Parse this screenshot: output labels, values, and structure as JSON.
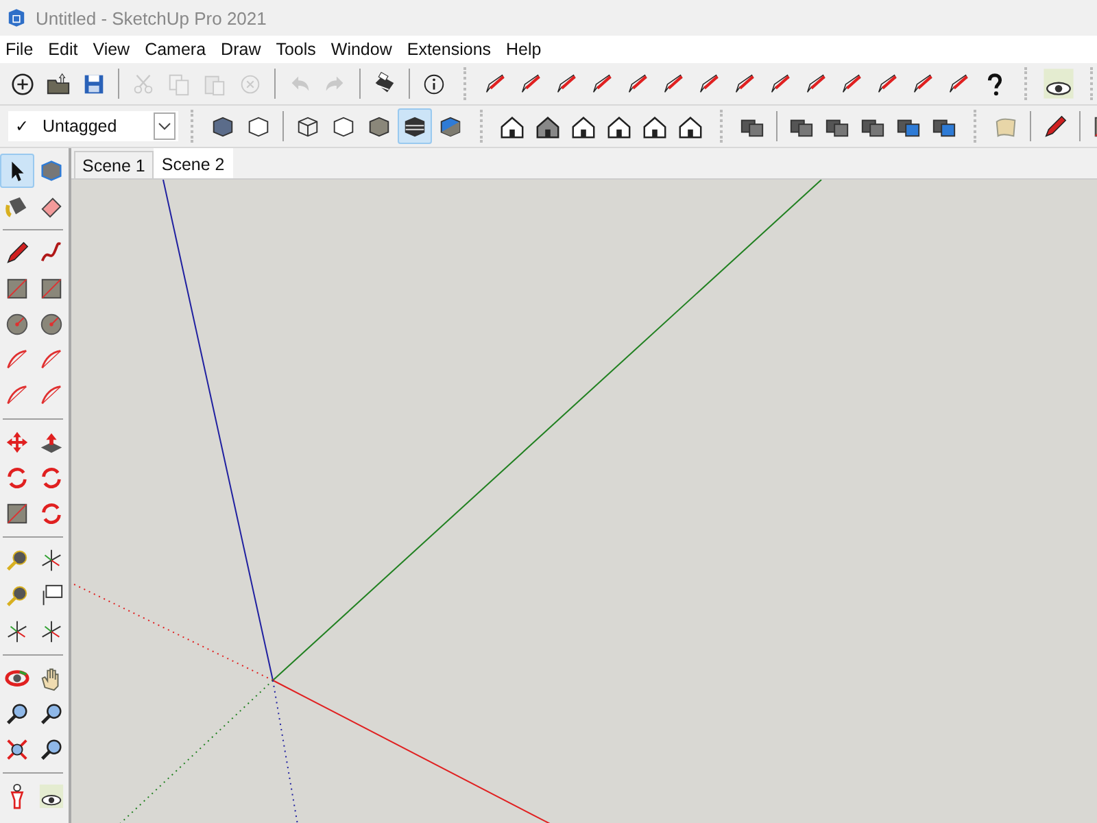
{
  "window": {
    "title": "Untitled - SketchUp Pro 2021"
  },
  "menu": [
    "File",
    "Edit",
    "View",
    "Camera",
    "Draw",
    "Tools",
    "Window",
    "Extensions",
    "Help"
  ],
  "standard_toolbar": [
    {
      "disabled": false
    },
    {
      "disabled": false
    },
    {
      "disabled": false
    },
    {
      "disabled": true
    },
    {
      "disabled": true
    },
    {
      "disabled": true
    },
    {
      "disabled": true
    },
    {
      "disabled": true
    },
    {
      "disabled": true
    },
    {
      "disabled": false
    },
    {
      "disabled": false
    }
  ],
  "tag_dropdown": {
    "mark": "✓",
    "value": "Untagged"
  },
  "style_buttons": [
    {
      "selected": false
    },
    {
      "selected": false
    },
    {
      "selected": false
    },
    {
      "selected": false
    },
    {
      "selected": false
    },
    {
      "selected": true
    },
    {
      "selected": false
    }
  ],
  "scene_tabs": [
    {
      "label": "Scene 1",
      "selected": false
    },
    {
      "label": "Scene 2",
      "selected": true
    }
  ],
  "tool_palette": [
    {
      "selected": true
    },
    {
      "selected": false
    },
    {
      "selected": false
    },
    {
      "selected": false
    }
  ]
}
